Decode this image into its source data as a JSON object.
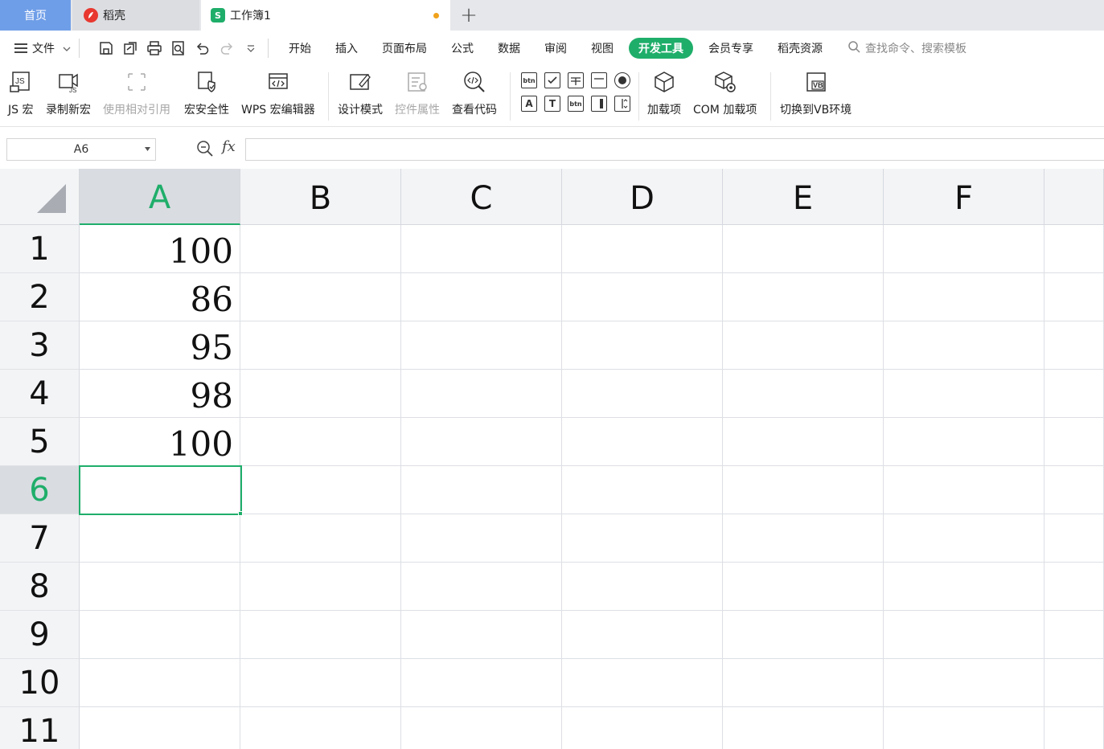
{
  "tabs": {
    "home": "首页",
    "daoke": "稻壳",
    "workbook": "工作簿1",
    "workbook_logo": "S",
    "add": "+"
  },
  "menu": {
    "file": "文件",
    "items": [
      "开始",
      "插入",
      "页面布局",
      "公式",
      "数据",
      "审阅",
      "视图",
      "开发工具",
      "会员专享",
      "稻壳资源"
    ],
    "active": "开发工具",
    "search_placeholder": "查找命令、搜索模板"
  },
  "ribbon": {
    "js_macro": "JS 宏",
    "record_macro": "录制新宏",
    "relative_ref": "使用相对引用",
    "macro_security": "宏安全性",
    "wps_macro_editor": "WPS 宏编辑器",
    "design_mode": "设计模式",
    "control_props": "控件属性",
    "view_code": "查看代码",
    "addins": "加载项",
    "com_addins": "COM 加载项",
    "switch_vb": "切换到VB环境"
  },
  "formula_bar": {
    "name_box": "A6",
    "fx": "fx",
    "formula": ""
  },
  "sheet": {
    "columns": [
      "A",
      "B",
      "C",
      "D",
      "E",
      "F"
    ],
    "rows": [
      "1",
      "2",
      "3",
      "4",
      "5",
      "6",
      "7",
      "8",
      "9",
      "10",
      "11"
    ],
    "column_a_values": [
      "100",
      "86",
      "95",
      "98",
      "100"
    ],
    "selected_cell": "A6"
  },
  "colors": {
    "accent": "#1fae6a",
    "home_tab": "#6f9ee8",
    "daoke_logo": "#e8382f",
    "unsaved_dot": "#f0a21c"
  }
}
